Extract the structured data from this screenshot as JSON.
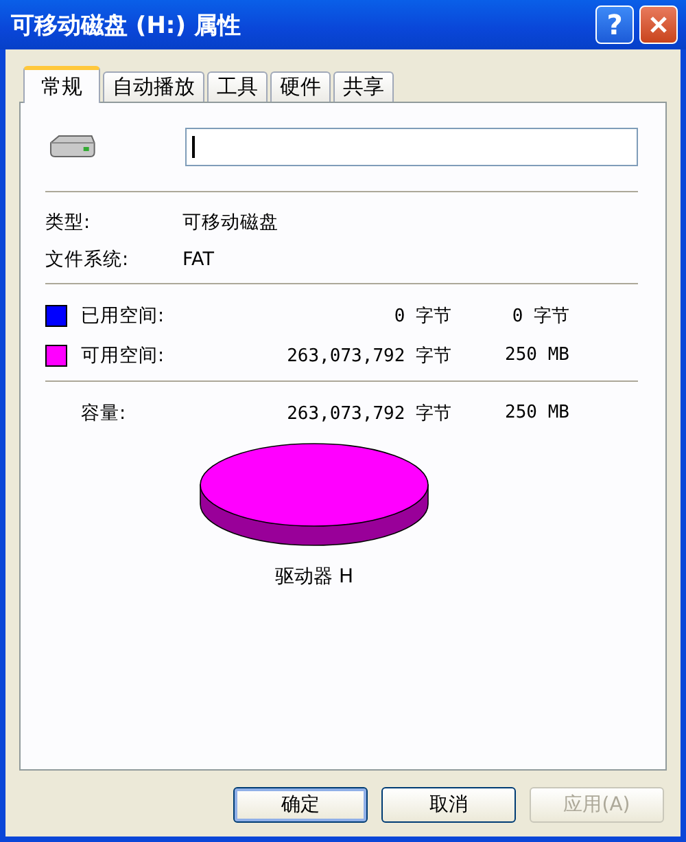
{
  "window": {
    "title": "可移动磁盘 (H:) 属性",
    "help_label": "?"
  },
  "tabs": [
    {
      "label": "常规",
      "selected": true
    },
    {
      "label": "自动播放",
      "selected": false
    },
    {
      "label": "工具",
      "selected": false
    },
    {
      "label": "硬件",
      "selected": false
    },
    {
      "label": "共享",
      "selected": false
    }
  ],
  "properties": [
    {
      "label": "类型:",
      "value": "可移动磁盘"
    },
    {
      "label": "文件系统:",
      "value": "FAT"
    }
  ],
  "space": [
    {
      "label": "已用空间:",
      "bytes": "0 字节",
      "size": "0 字节",
      "color": "#0000ff"
    },
    {
      "label": "可用空间:",
      "bytes": "263,073,792 字节",
      "size": "250 MB",
      "color": "#ff00ff"
    }
  ],
  "capacity": {
    "label": "容量:",
    "bytes": "263,073,792 字节",
    "size": "250 MB"
  },
  "drive_label": "驱动器 H",
  "buttons": [
    {
      "label": "确定",
      "default": true,
      "disabled": false
    },
    {
      "label": "取消",
      "default": false,
      "disabled": false
    },
    {
      "label": "应用(A)",
      "default": false,
      "disabled": true
    }
  ]
}
